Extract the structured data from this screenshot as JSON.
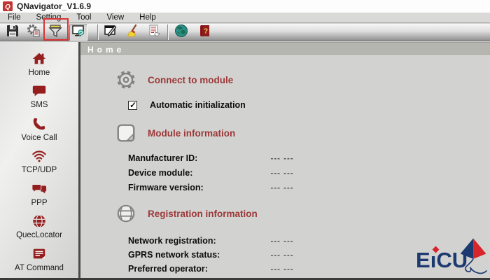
{
  "window": {
    "title": "QNavigator_V1.6.9",
    "app_icon": "q-logo-icon"
  },
  "menu": {
    "items": [
      "File",
      "Setting",
      "Tool",
      "View",
      "Help"
    ]
  },
  "toolbar": {
    "buttons": [
      {
        "icon": "save-icon"
      },
      {
        "icon": "settings-icon"
      },
      {
        "icon": "connect-module-icon",
        "highlighted": true
      },
      {
        "icon": "view-monitor-icon",
        "pressed": true
      },
      {
        "icon": "edit-window-icon"
      },
      {
        "icon": "clear-broom-icon"
      },
      {
        "icon": "report-icon"
      },
      {
        "icon": "world-icon"
      },
      {
        "icon": "help-book-icon"
      }
    ],
    "highlight_color": "#d93535"
  },
  "sidebar": {
    "items": [
      {
        "icon": "home-icon",
        "label": "Home"
      },
      {
        "icon": "sms-icon",
        "label": "SMS"
      },
      {
        "icon": "voice-call-icon",
        "label": "Voice Call"
      },
      {
        "icon": "wifi-icon",
        "label": "TCP/UDP"
      },
      {
        "icon": "chat-bubbles-icon",
        "label": "PPP"
      },
      {
        "icon": "globe-icon",
        "label": "QuecLocator"
      },
      {
        "icon": "document-icon",
        "label": "AT Command"
      }
    ]
  },
  "main": {
    "tab_label": "Home",
    "sections": [
      {
        "icon": "gear-icon",
        "title": "Connect to module",
        "checkbox": {
          "checked": true,
          "label": "Automatic initialization"
        }
      },
      {
        "icon": "note-icon",
        "title": "Module information",
        "fields": [
          {
            "label": "Manufacturer ID:",
            "value": "--- ---"
          },
          {
            "label": "Device module:",
            "value": "--- ---"
          },
          {
            "label": "Firmware version:",
            "value": "--- ---"
          }
        ]
      },
      {
        "icon": "globe-outline-icon",
        "title": "Registration information",
        "fields": [
          {
            "label": "Network registration:",
            "value": "--- ---"
          },
          {
            "label": "GPRS network status:",
            "value": "--- ---"
          },
          {
            "label": "Preferred operator:",
            "value": "--- ---"
          }
        ]
      }
    ]
  },
  "logo": {
    "part_e": "E",
    "part_i": "ı",
    "part_cu": "CU",
    "text": "EICU"
  },
  "colors": {
    "accent_red": "#9c3838",
    "sidebar_icon_red": "#951f1f",
    "logo_navy": "#1d3a70",
    "logo_red": "#d6252b",
    "highlight_red": "#d93535"
  }
}
